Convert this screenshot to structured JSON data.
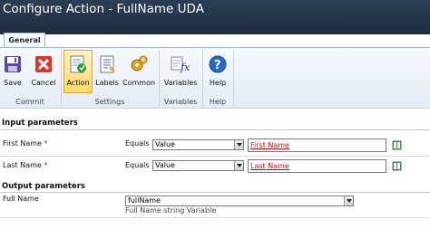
{
  "window": {
    "title": "Configure Action - FullName UDA"
  },
  "tabs": [
    {
      "label": "General"
    }
  ],
  "ribbon": {
    "groups": [
      {
        "label": "Commit",
        "buttons": [
          {
            "label": "Save",
            "icon": "save-icon"
          },
          {
            "label": "Cancel",
            "icon": "cancel-icon"
          }
        ]
      },
      {
        "label": "Settings",
        "buttons": [
          {
            "label": "Action",
            "icon": "action-icon",
            "active": true
          },
          {
            "label": "Labels",
            "icon": "labels-icon"
          },
          {
            "label": "Common",
            "icon": "gears-icon"
          }
        ]
      },
      {
        "label": "Variables",
        "buttons": [
          {
            "label": "Variables",
            "icon": "fx-icon"
          }
        ]
      },
      {
        "label": "Help",
        "buttons": [
          {
            "label": "Help",
            "icon": "help-icon"
          }
        ]
      }
    ]
  },
  "input_section": {
    "title": "Input parameters",
    "rows": [
      {
        "label": "First Name",
        "required_mark": "*",
        "operator": "Equals",
        "type_value": "Value",
        "value": "First Name"
      },
      {
        "label": "Last Name",
        "required_mark": "*",
        "operator": "Equals",
        "type_value": "Value",
        "value": "Last Name"
      }
    ]
  },
  "output_section": {
    "title": "Output parameters",
    "rows": [
      {
        "label": "Full Name",
        "selected": "fullName",
        "hint": "Full Name string Variable"
      }
    ]
  },
  "colors": {
    "title_bar": "#24344a",
    "active_button": "#ffd86a",
    "token_text": "#d01010",
    "required": "#d01010"
  }
}
